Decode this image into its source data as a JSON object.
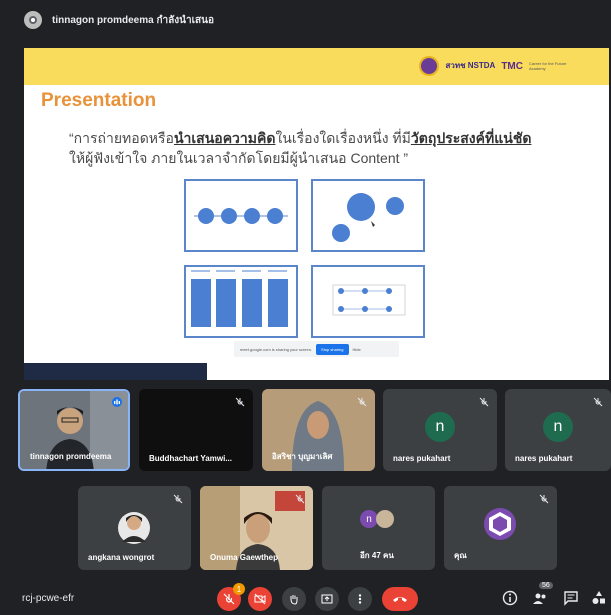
{
  "topbar": {
    "presenter_title": "tinnagon promdeema กำลังนำเสนอ"
  },
  "slide": {
    "heading": "Presentation",
    "quote_part1": "“การถ่ายทอดหรือ",
    "quote_bold1": "นำเสนอความคิด",
    "quote_part2": "ในเรื่องใดเรื่องหนึ่ง ที่มี",
    "quote_bold2": "วัตถุประสงค์ที่แน่ชัด",
    "quote_line2": "ให้ผู้ฟังเข้าใจ ภายในเวลาจำกัดโดยมีผู้นำเสนอ Content ”",
    "logo_nstda": "สวทช NSTDA",
    "logo_tmc": "TMC",
    "logo_tagline": "Career for the Future Academy",
    "share_text": "meet.google.com is sharing your screen.",
    "share_stop": "Stop sharing",
    "share_hide": "Hide"
  },
  "participants_row1": [
    {
      "name": "tinnagon promdeema"
    },
    {
      "name": "Buddhachart Yamwi..."
    },
    {
      "name": "อิสริชา บุญมาเลิศ"
    },
    {
      "name": "nares pukahart",
      "initial": "n"
    },
    {
      "name": "nares pukahart",
      "initial": "n"
    }
  ],
  "participants_row2": [
    {
      "name": "angkana wongrot"
    },
    {
      "name": "Onuma Gaewthep"
    },
    {
      "name": "อีก 47 คน",
      "initial": "n"
    },
    {
      "name": "คุณ"
    }
  ],
  "bottombar": {
    "meeting_code": "rcj-pcwe-efr",
    "people_count": "56",
    "reaction_badge": "1"
  },
  "colors": {
    "accent_yellow": "#f9dc5c",
    "heading_orange": "#e8923a",
    "diagram_blue": "#5b86c9",
    "end_call_red": "#ea4335",
    "tile_gray": "#3c4043"
  }
}
